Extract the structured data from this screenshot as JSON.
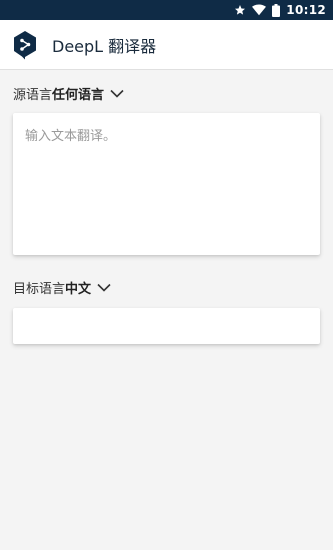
{
  "status_bar": {
    "time": "10:12",
    "icons": [
      "star-icon",
      "wifi-icon",
      "battery-icon"
    ],
    "background": "#0f2b46"
  },
  "app_bar": {
    "title": "DeepL 翻译器",
    "logo_color": "#0f2b46"
  },
  "source": {
    "label": "源语言",
    "value": "任何语言",
    "placeholder": "输入文本翻译。",
    "text": ""
  },
  "target": {
    "label": "目标语言",
    "value": "中文",
    "text": ""
  },
  "colors": {
    "background": "#f4f4f4",
    "card": "#ffffff",
    "brand": "#0f2b46"
  }
}
